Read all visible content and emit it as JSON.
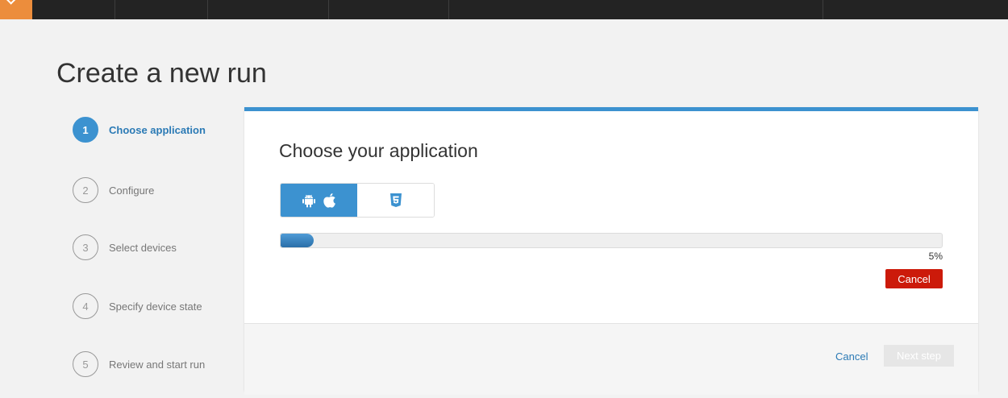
{
  "page": {
    "title": "Create a new run"
  },
  "steps": [
    {
      "number": "1",
      "label": "Choose application"
    },
    {
      "number": "2",
      "label": "Configure"
    },
    {
      "number": "3",
      "label": "Select devices"
    },
    {
      "number": "4",
      "label": "Specify device state"
    },
    {
      "number": "5",
      "label": "Review and start run"
    }
  ],
  "active_step": 1,
  "card": {
    "title": "Choose your application",
    "app_type_options": [
      {
        "icons": [
          "android-icon",
          "apple-icon"
        ],
        "selected": true
      },
      {
        "icons": [
          "html5-icon"
        ],
        "selected": false
      }
    ],
    "upload": {
      "progress": 0.05,
      "percent_label": "5%",
      "cancel_label": "Cancel"
    }
  },
  "footer": {
    "cancel_label": "Cancel",
    "next_label": "Next step"
  },
  "colors": {
    "accent": "#3c92d0",
    "danger": "#cc1a0a",
    "topbar": "#232323",
    "brand": "#ec8d3c"
  }
}
